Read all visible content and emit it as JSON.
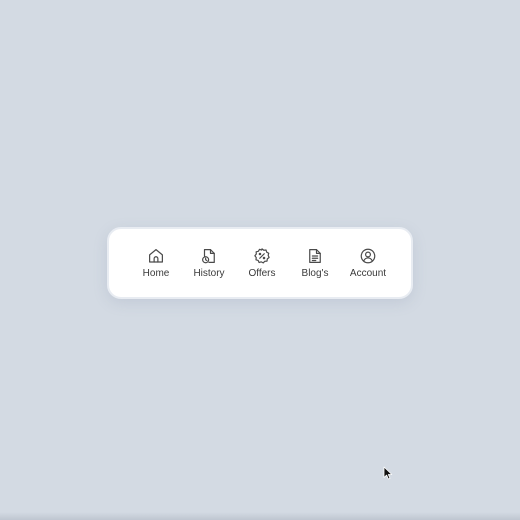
{
  "nav": {
    "items": [
      {
        "label": "Home",
        "icon": "home-icon"
      },
      {
        "label": "History",
        "icon": "history-document-icon"
      },
      {
        "label": "Offers",
        "icon": "percent-badge-icon"
      },
      {
        "label": "Blog's",
        "icon": "document-icon"
      },
      {
        "label": "Account",
        "icon": "user-circle-icon"
      }
    ]
  },
  "colors": {
    "background": "#d3dae3",
    "card": "#ffffff",
    "icon": "#4a4a4a",
    "label": "#3a3a3a"
  }
}
